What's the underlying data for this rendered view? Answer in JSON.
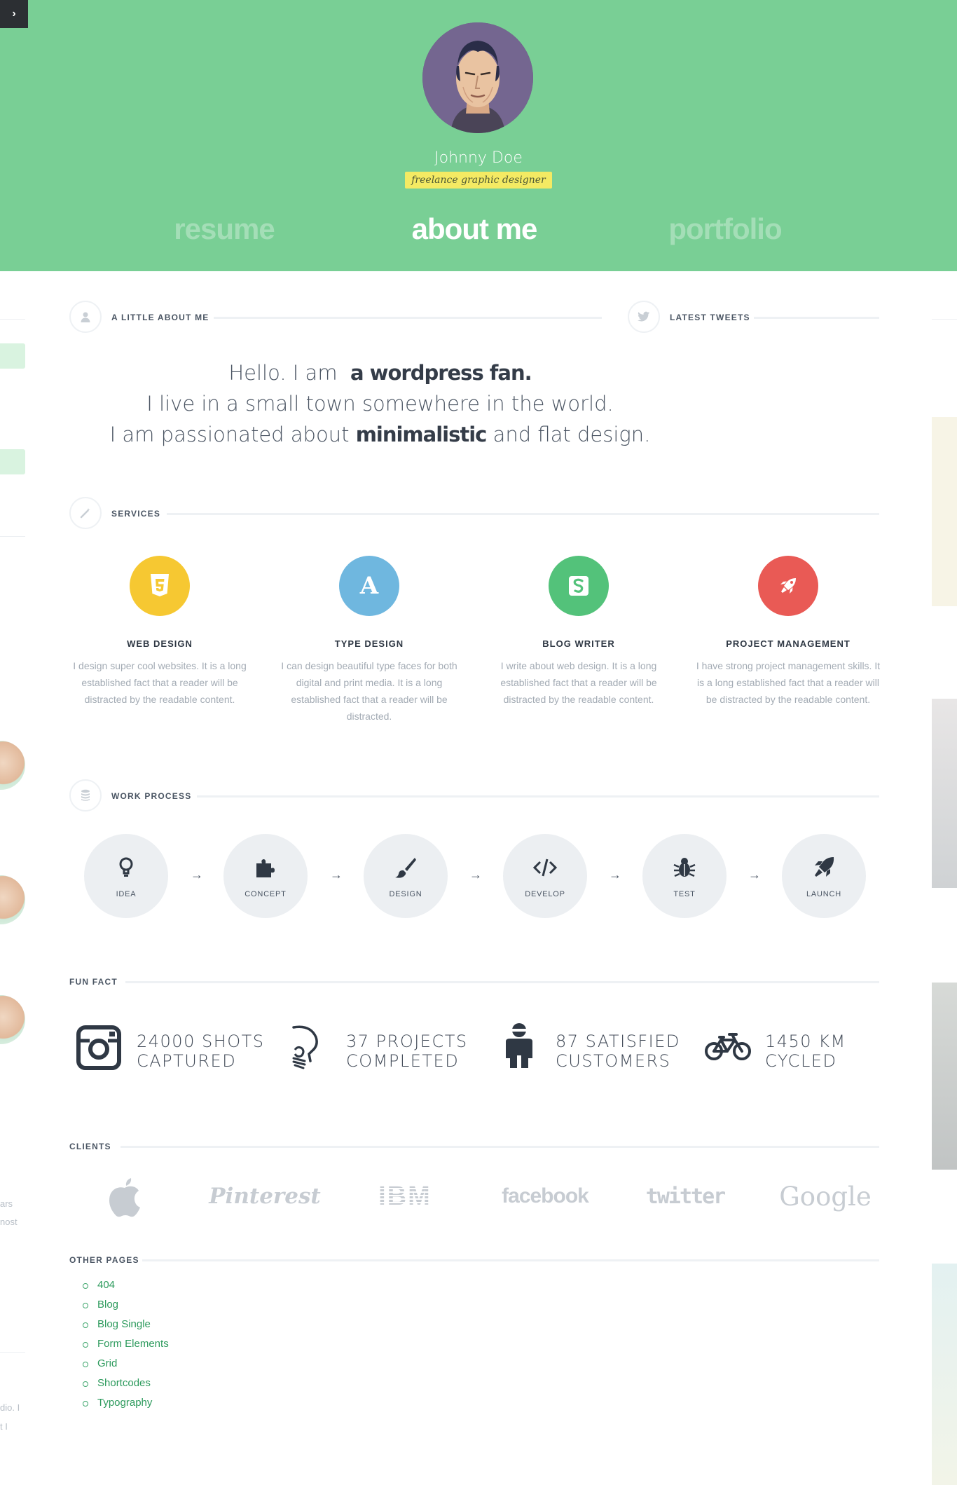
{
  "sidebar_toggle": {
    "icon": "chevron-right-icon",
    "glyph": "›"
  },
  "hero": {
    "name": "Johnny Doe",
    "role": "freelance graphic designer",
    "nav": [
      {
        "label": "resume",
        "active": false
      },
      {
        "label": "about me",
        "active": true
      },
      {
        "label": "portfolio",
        "active": false
      }
    ],
    "background_color": "#79cf95",
    "role_highlight_color": "#f4ea63"
  },
  "about": {
    "title": "A LITTLE ABOUT ME",
    "icon": "user-icon",
    "line1_pre": "Hello. I am",
    "line1_bold": "a wordpress fan.",
    "line2": "I live in a small town somewhere in the world.",
    "line3_pre": "I am passionated about",
    "line3_bold": "minimalistic",
    "line3_post": "and flat design."
  },
  "tweets": {
    "title": "LATEST TWEETS",
    "icon": "twitter-icon"
  },
  "services": {
    "title": "SERVICES",
    "icon": "magic-wand-icon",
    "items": [
      {
        "title": "WEB DESIGN",
        "desc": "I design super cool websites. It is a long established fact that a reader will be distracted by the readable content.",
        "icon": "html5-icon",
        "color": "#f6c832"
      },
      {
        "title": "TYPE DESIGN",
        "desc": "I can design beautiful type faces for both digital and print media. It is a long established fact that a reader will be distracted.",
        "icon": "letter-a-icon",
        "glyph": "A",
        "color": "#6fb7df"
      },
      {
        "title": "BLOG WRITER",
        "desc": "I write about web design. It is a long established fact that a reader will be distracted by the readable content.",
        "icon": "squarespace-icon",
        "color": "#53c27a"
      },
      {
        "title": "PROJECT MANAGEMENT",
        "desc": "I have strong project management skills. It is a long established fact that a reader will be distracted by the readable content.",
        "icon": "rocket-icon",
        "color": "#e95a55"
      }
    ]
  },
  "process": {
    "title": "WORK PROCESS",
    "icon": "database-icon",
    "arrow": "→",
    "steps": [
      {
        "label": "IDEA",
        "icon": "lightbulb-icon"
      },
      {
        "label": "CONCEPT",
        "icon": "puzzle-icon"
      },
      {
        "label": "DESIGN",
        "icon": "brush-icon"
      },
      {
        "label": "DEVELOP",
        "icon": "code-icon"
      },
      {
        "label": "TEST",
        "icon": "bug-icon"
      },
      {
        "label": "LAUNCH",
        "icon": "rocket-icon"
      }
    ]
  },
  "fun_fact": {
    "title": "FUN FACT",
    "items": [
      {
        "number": "24000 SHOTS",
        "label": "CAPTURED",
        "icon": "instagram-icon"
      },
      {
        "number": "37 PROJECTS",
        "label": "COMPLETED",
        "icon": "head-lightbulb-icon"
      },
      {
        "number": "87 SATISFIED",
        "label": "CUSTOMERS",
        "icon": "person-icon"
      },
      {
        "number": "1450 KM",
        "label": "CYCLED",
        "icon": "bicycle-icon"
      }
    ]
  },
  "clients": {
    "title": "CLIENTS",
    "logos": [
      {
        "name": "apple",
        "text": "",
        "icon": "apple-logo-icon"
      },
      {
        "name": "pinterest",
        "text": "Pinterest"
      },
      {
        "name": "ibm",
        "text": "IBM"
      },
      {
        "name": "facebook",
        "text": "facebook"
      },
      {
        "name": "twitter",
        "text": "twitter"
      },
      {
        "name": "google",
        "text": "Google"
      }
    ]
  },
  "other_pages": {
    "title": "OTHER PAGES",
    "links": [
      "404",
      "Blog",
      "Blog Single",
      "Form Elements",
      "Grid",
      "Shortcodes",
      "Typography"
    ]
  },
  "left_edge": {
    "fragments": [
      "ars",
      "nost",
      "dio. I",
      "t I"
    ]
  }
}
